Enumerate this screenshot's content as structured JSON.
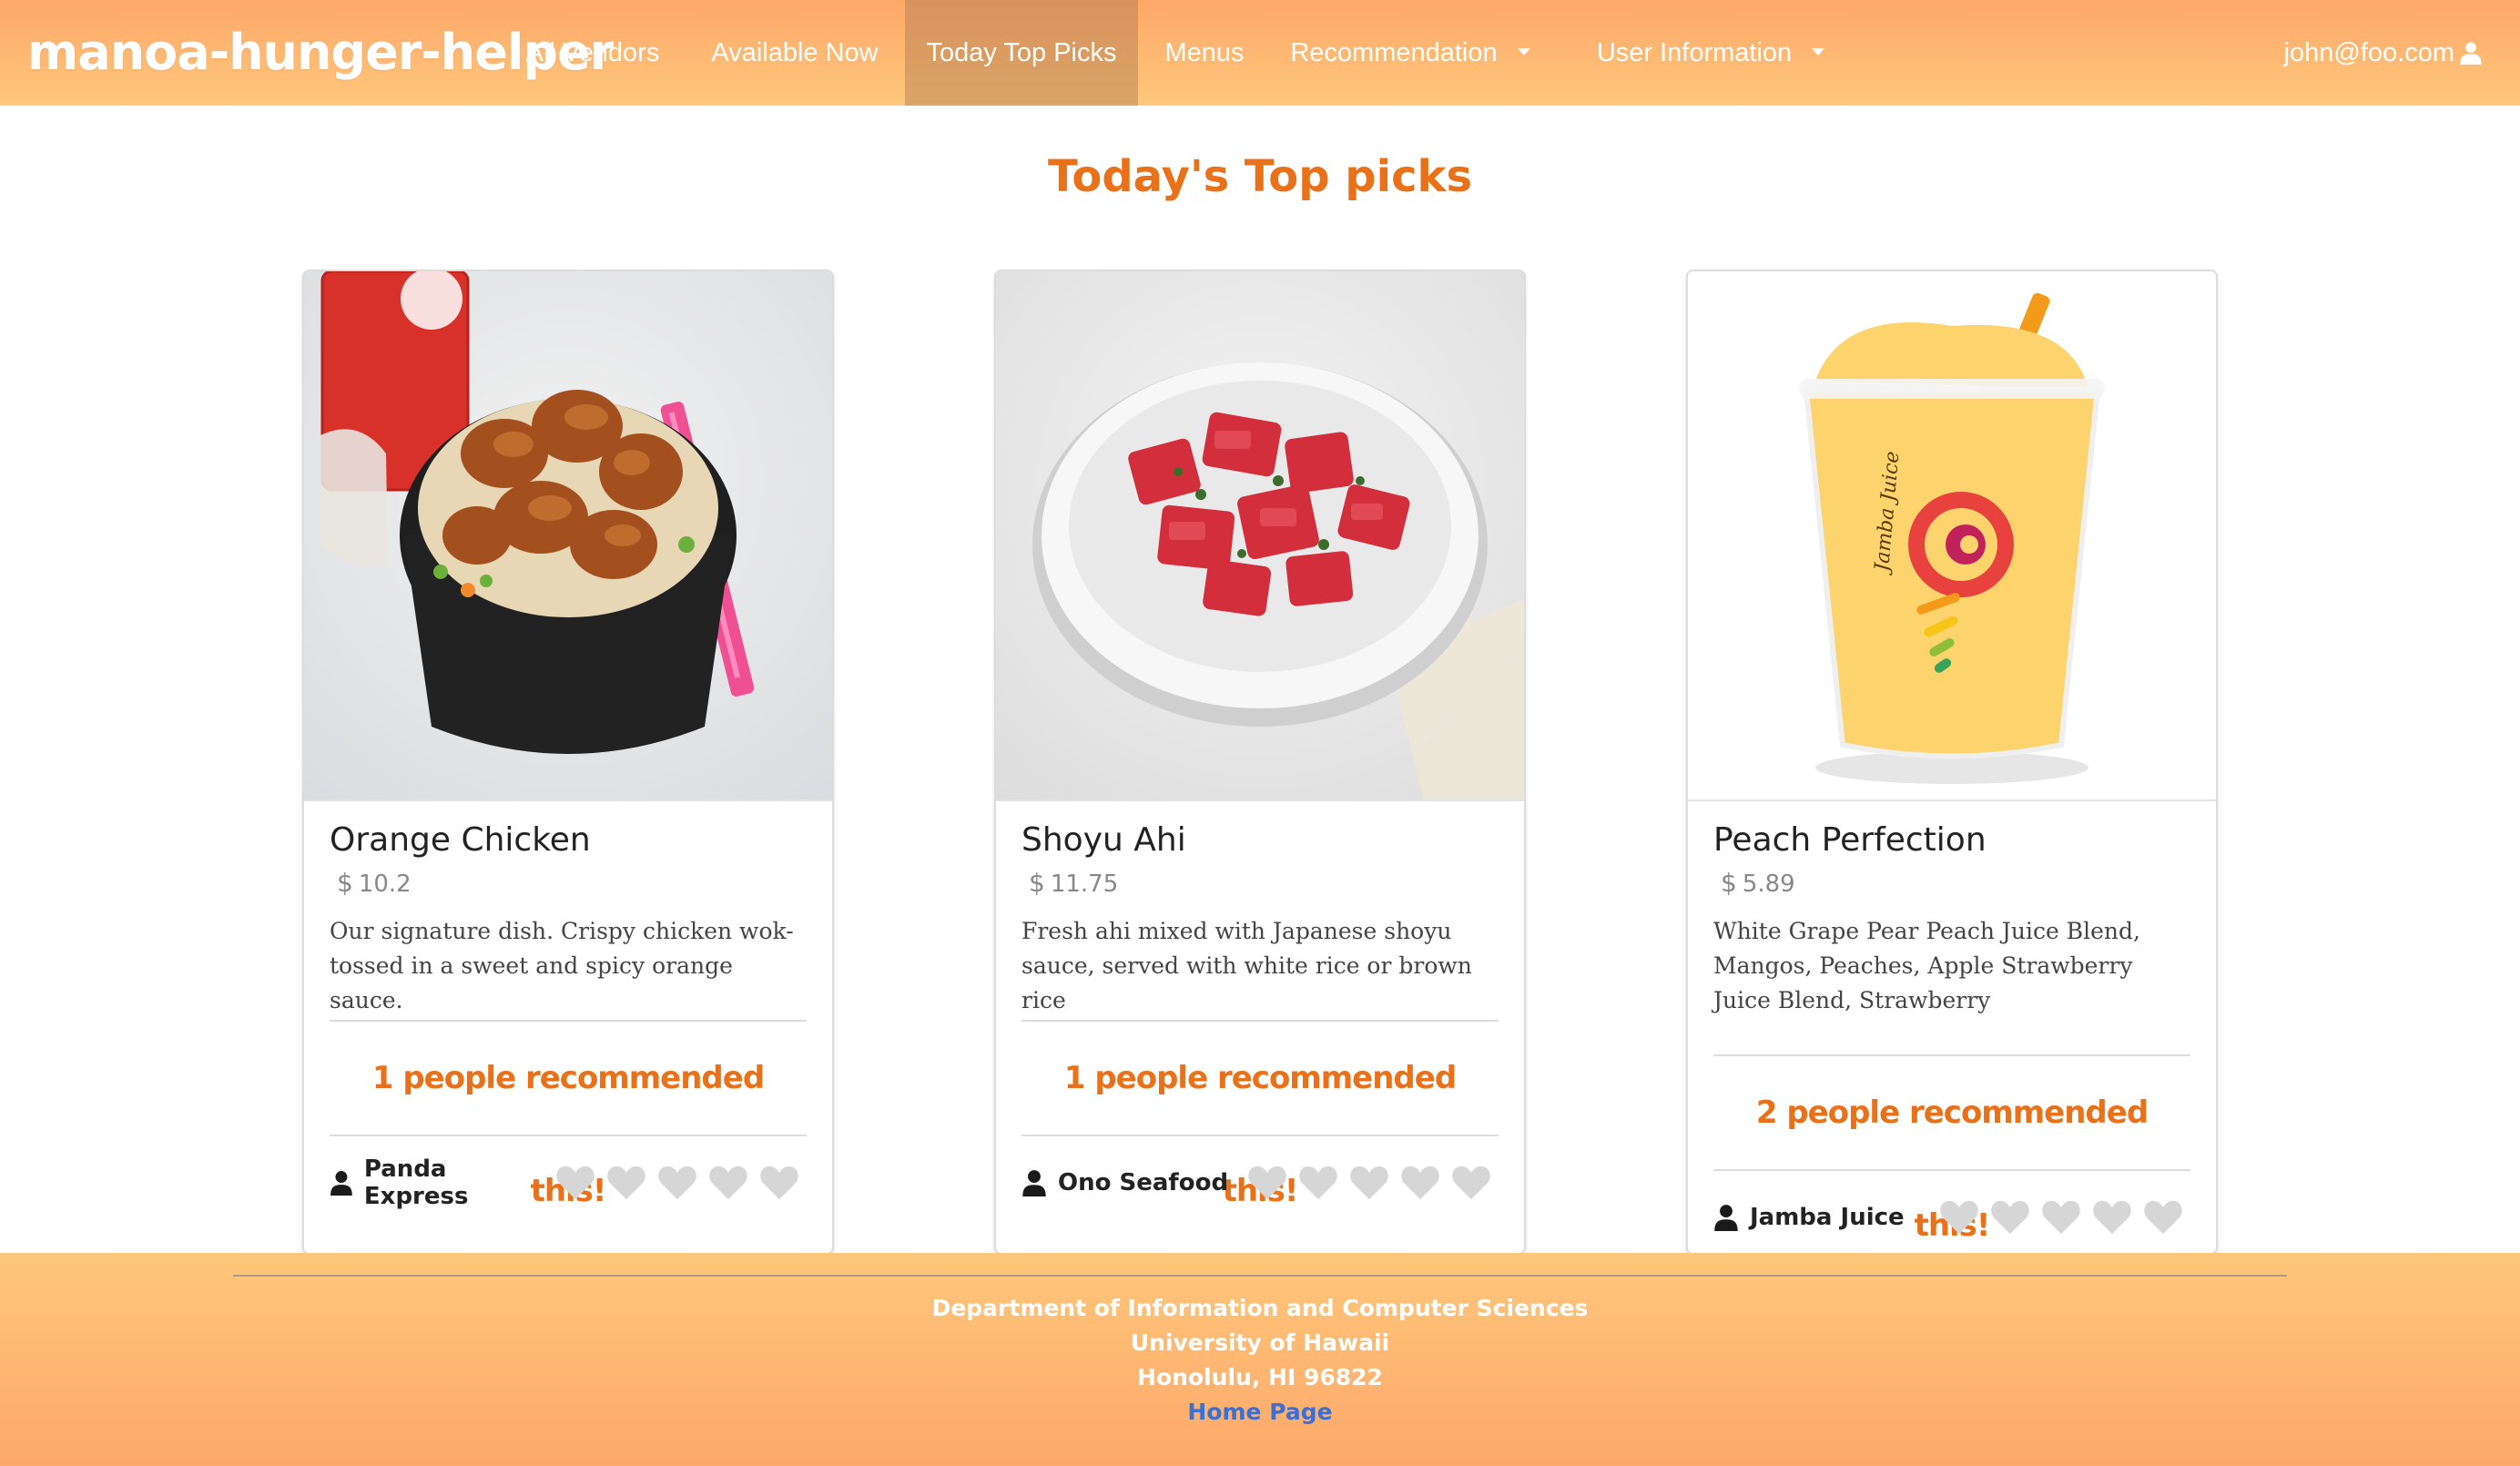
{
  "navbar": {
    "brand": "manoa-hunger-helper",
    "items": [
      {
        "label": "All Vendors"
      },
      {
        "label": "Available Now"
      },
      {
        "label": "Today Top Picks",
        "active": true
      },
      {
        "label": "Menus"
      },
      {
        "label": "Recommendation",
        "dropdown": true
      },
      {
        "label": "User Information",
        "dropdown": true
      }
    ],
    "user_email": "john@foo.com"
  },
  "page": {
    "title": "Today's Top picks"
  },
  "cards": [
    {
      "title": "Orange Chicken",
      "price": "10.2",
      "currency_symbol": "$",
      "description": "Our signature dish. Crispy chicken wok-tossed in a sweet and spicy orange sauce.",
      "recommend_text": "1 people recommended this!",
      "vendor": "Panda Express",
      "image": "orange chicken bowl photo",
      "hearts": 5
    },
    {
      "title": "Shoyu Ahi",
      "price": "11.75",
      "currency_symbol": "$",
      "description": "Fresh ahi mixed with Japanese shoyu sauce, served with white rice or brown rice",
      "recommend_text": "1 people recommended this!",
      "vendor": "Ono Seafood",
      "image": "shoyu ahi poke bowl photo",
      "hearts": 5
    },
    {
      "title": "Peach Perfection",
      "price": "5.89",
      "currency_symbol": "$",
      "description": "White Grape Pear Peach Juice Blend, Mangos, Peaches, Apple Strawberry Juice Blend, Strawberry",
      "recommend_text": "2 people recommended this!",
      "vendor": "Jamba Juice",
      "image": "peach smoothie cup photo",
      "cup_brand": "Jamba Juice",
      "hearts": 5
    }
  ],
  "footer": {
    "line1": "Department of Information and Computer Sciences",
    "line2": "University of Hawaii",
    "line3": "Honolulu, HI 96822",
    "link": "Home Page"
  },
  "colors": {
    "accent": "#e8711a",
    "nav_gradient_top": "#fda86a",
    "nav_gradient_bottom": "#fec77a",
    "heart_inactive": "#d6d6d6",
    "link": "#3b6fd1"
  }
}
